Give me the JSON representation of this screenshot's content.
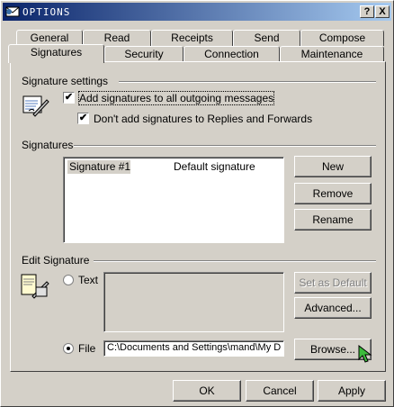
{
  "window": {
    "title": "OPTIONS",
    "help_label": "?",
    "close_label": "X"
  },
  "tabs_back": [
    "General",
    "Read",
    "Receipts",
    "Send",
    "Compose"
  ],
  "tabs_front": [
    "Signatures",
    "Security",
    "Connection",
    "Maintenance"
  ],
  "active_tab": "Signatures",
  "signature_settings": {
    "heading": "Signature settings",
    "add_all_label": "Add signatures to all outgoing messages",
    "add_all_checked": true,
    "no_replies_label": "Don't add signatures to Replies and Forwards",
    "no_replies_checked": true
  },
  "signatures": {
    "heading": "Signatures",
    "items": [
      {
        "name": "Signature #1",
        "note": "Default signature"
      }
    ],
    "new_label": "New",
    "remove_label": "Remove",
    "rename_label": "Rename"
  },
  "edit_signature": {
    "heading": "Edit Signature",
    "text_label": "Text",
    "file_label": "File",
    "selected": "File",
    "file_path": "C:\\Documents and Settings\\mand\\My D",
    "set_default_label": "Set as Default",
    "advanced_label": "Advanced...",
    "browse_label": "Browse..."
  },
  "dialog": {
    "ok_label": "OK",
    "cancel_label": "Cancel",
    "apply_label": "Apply"
  }
}
